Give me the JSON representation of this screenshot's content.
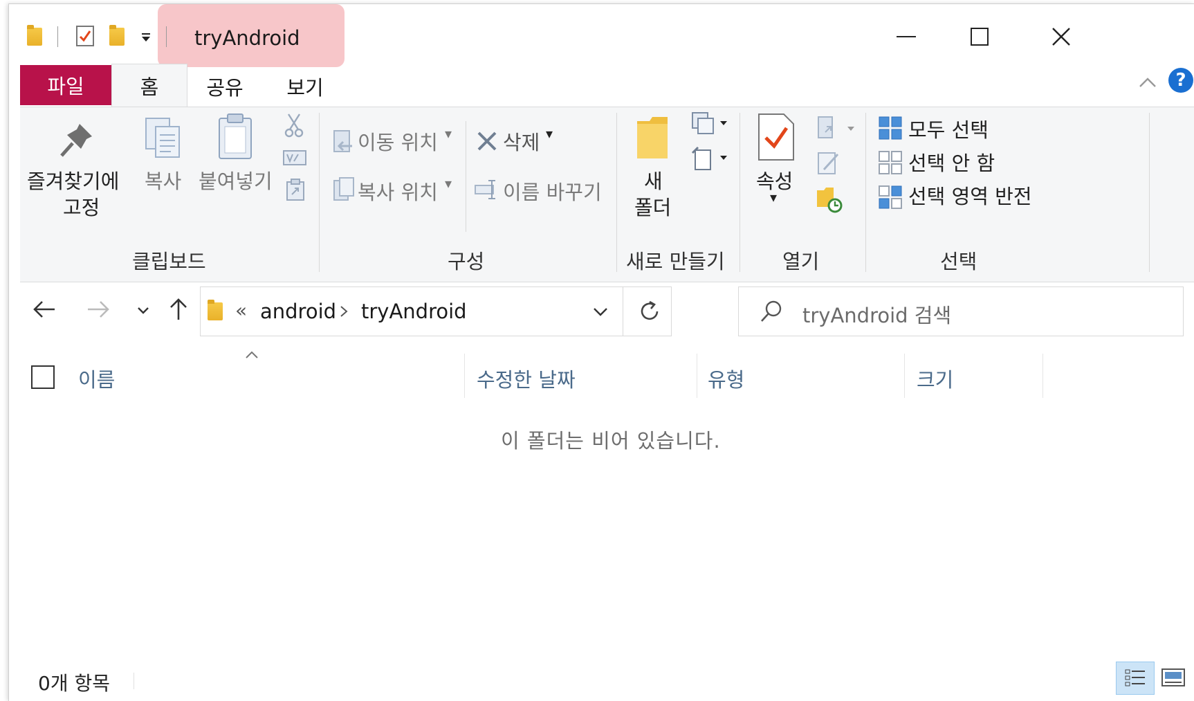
{
  "window": {
    "title": "tryAndroid",
    "controls": {
      "minimize": "—",
      "maximize": "☐",
      "close": "✕"
    }
  },
  "ribbon": {
    "tabs": [
      {
        "label": "파일",
        "active": false
      },
      {
        "label": "홈",
        "active": true
      },
      {
        "label": "공유",
        "active": false
      },
      {
        "label": "보기",
        "active": false
      }
    ],
    "clipboard": {
      "pin_line1": "즐겨찾기에",
      "pin_line2": "고정",
      "copy": "복사",
      "paste": "붙여넣기",
      "group": "클립보드"
    },
    "organize": {
      "move_to": "이동 위치",
      "copy_to": "복사 위치",
      "delete": "삭제",
      "rename": "이름 바꾸기",
      "group": "구성"
    },
    "new": {
      "new_folder_line1": "새",
      "new_folder_line2": "폴더",
      "group": "새로 만들기"
    },
    "open": {
      "properties": "속성",
      "group": "열기"
    },
    "select": {
      "select_all": "모두 선택",
      "select_none": "선택 안 함",
      "invert": "선택 영역 반전",
      "group": "선택"
    }
  },
  "address": {
    "overflow": "«",
    "crumbs": [
      "android",
      "tryAndroid"
    ],
    "search_placeholder": "tryAndroid 검색"
  },
  "columns": [
    "이름",
    "수정한 날짜",
    "유형",
    "크기"
  ],
  "content": {
    "empty_message": "이 폴더는 비어 있습니다."
  },
  "status": {
    "item_count": "0개 항목"
  },
  "colors": {
    "file_tab": "#b8124a",
    "accent_blue": "#1e78d2",
    "help": "#1a6fd1"
  }
}
